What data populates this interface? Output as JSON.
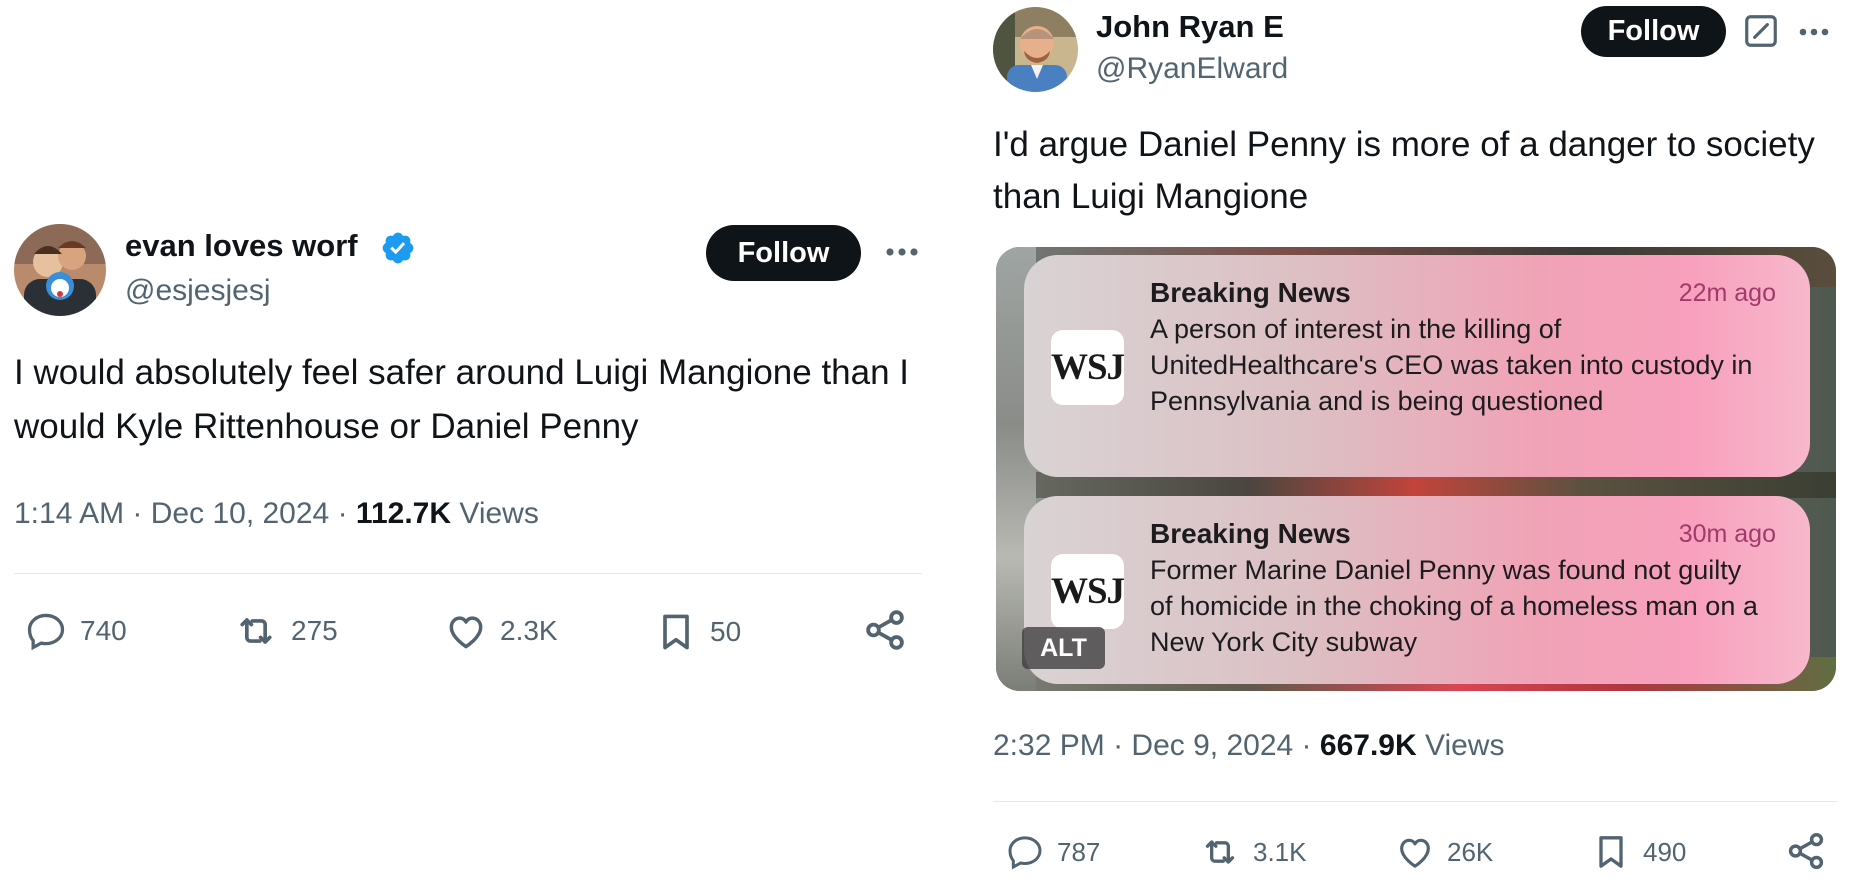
{
  "left_tweet": {
    "display_name": "evan loves worf",
    "handle": "@esjesjesj",
    "follow_label": "Follow",
    "text": "I would absolutely feel safer around Luigi Mangione than I would Kyle Rittenhouse or Daniel Penny",
    "time": "1:14 AM",
    "date": "Dec 10, 2024",
    "views_count": "112.7K",
    "views_label": "Views",
    "replies": "740",
    "reposts": "275",
    "likes": "2.3K",
    "bookmarks": "50",
    "verified_color": "#1d9bf0"
  },
  "right_tweet": {
    "display_name": "John Ryan E",
    "handle": "@RyanElward",
    "follow_label": "Follow",
    "text": "I'd argue Daniel Penny is more of a danger to society than Luigi Mangione",
    "time": "2:32 PM",
    "date": "Dec 9, 2024",
    "views_count": "667.9K",
    "views_label": "Views",
    "replies": "787",
    "reposts": "3.1K",
    "likes": "26K",
    "bookmarks": "490",
    "media": {
      "alt_label": "ALT",
      "notifications": [
        {
          "logo": "WSJ",
          "title": "Breaking News",
          "time": "22m ago",
          "body": "A person of interest in the killing of UnitedHealthcare's CEO was taken into custody in Pennsylvania and is being questioned"
        },
        {
          "logo": "WSJ",
          "title": "Breaking News",
          "time": "30m ago",
          "body": "Former Marine Daniel Penny was found not guilty of homicide in the choking of a homeless man on a New York City subway"
        }
      ]
    }
  },
  "separator": "·",
  "icons": [
    "verified-badge-icon",
    "more-icon",
    "grok-icon",
    "reply-icon",
    "repost-icon",
    "like-icon",
    "bookmark-icon",
    "share-icon"
  ],
  "colors": {
    "text_primary": "#0f1419",
    "text_secondary": "#536471",
    "follow_bg": "#0f1419",
    "divider": "#e6e9ec"
  }
}
